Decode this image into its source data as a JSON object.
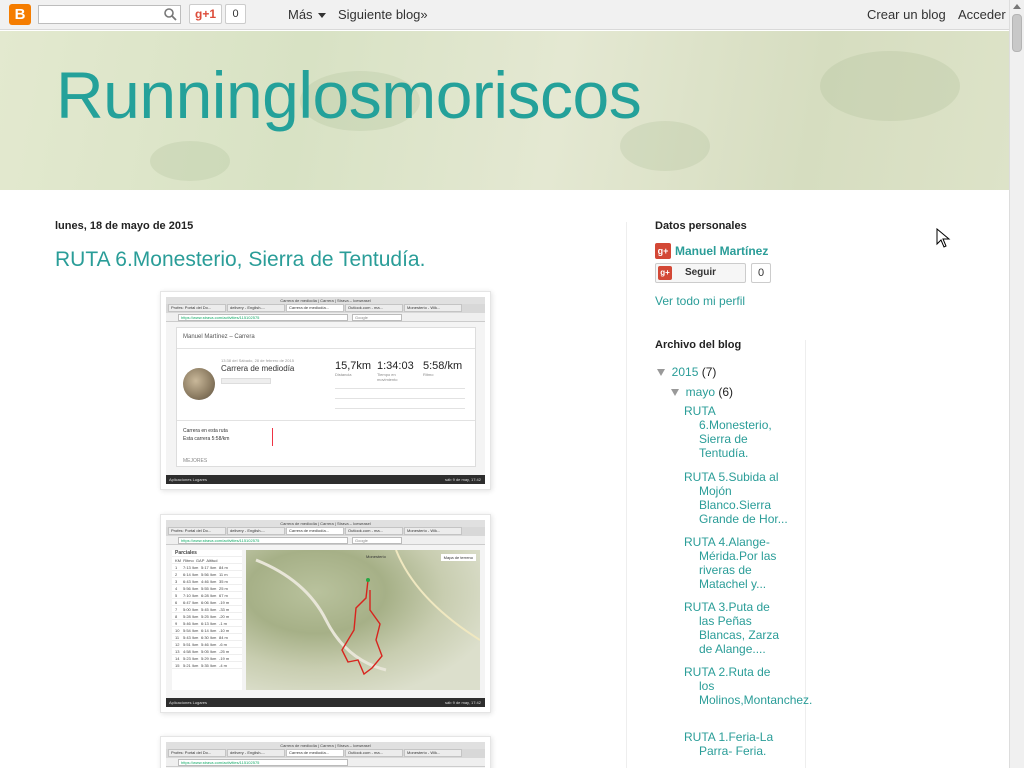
{
  "navbar": {
    "gplus_label": "g+1",
    "gplus_count": "0",
    "more_label": "Más",
    "next_blog_label": "Siguiente blog»",
    "create_blog_label": "Crear un blog",
    "login_label": "Acceder"
  },
  "header": {
    "title": "Runninglosmoriscos"
  },
  "post": {
    "date": "lunes, 18 de mayo de 2015",
    "title": "RUTA 6.Monesterio, Sierra de Tentudía."
  },
  "screens": {
    "window_title": "Carrera de mediodía | Carrera | Strava – Iceweasel",
    "tabs": [
      "Profes: Portal del Do...",
      "delivery - English-...",
      "Carrera de mediodía...",
      "Outlook.com - ma...",
      "Monesterio - Wik..."
    ],
    "url": "https://www.strava.com/activities/115102575",
    "search_placeholder": "Google",
    "taskbar": "Aplicaciones   Lugares",
    "taskbar_time": "sáb  9 de may, 17:42",
    "card": {
      "athlete": "Manuel Martínez – Carrera",
      "activity_date": "13:38 del Sábado, 28 de febrero de 2015",
      "activity_name": "Carrera de mediodía",
      "add_desc": "Añadir una descripción",
      "distance": "15,7km",
      "distance_label": "Distancia",
      "time": "1:34:03",
      "time_label": "Tiempo en movimiento",
      "pace": "5:58/km",
      "pace_label": "Ritmo",
      "segment_text": "Carrera en esta ruta",
      "segment_value": "Esta carrera 5:58/km",
      "best_label": "MEJORES",
      "goal": "Esta carrera"
    },
    "splits": {
      "title": "Parciales",
      "headers": [
        "KM",
        "Ritmo",
        "GAP",
        "Altitud"
      ],
      "rows": [
        [
          "1",
          "7:13 /km",
          "5:17 /km",
          "84 m"
        ],
        [
          "2",
          "6:14 /km",
          "5:56 /km",
          "11 m"
        ],
        [
          "3",
          "6:43 /km",
          "4:46 /km",
          "35 m"
        ],
        [
          "4",
          "5:56 /km",
          "5:55 /km",
          "25 m"
        ],
        [
          "5",
          "7:10 /km",
          "6:28 /km",
          "67 m"
        ],
        [
          "6",
          "6:47 /km",
          "6:06 /km",
          "-19 m"
        ],
        [
          "7",
          "5:00 /km",
          "5:45 /km",
          "-33 m"
        ],
        [
          "8",
          "5:28 /km",
          "5:25 /km",
          "-20 m"
        ],
        [
          "9",
          "5:46 /km",
          "6:13 /km",
          "-1 m"
        ],
        [
          "10",
          "5:54 /km",
          "6:14 /km",
          "-10 m"
        ],
        [
          "11",
          "5:43 /km",
          "6:30 /km",
          "84 m"
        ],
        [
          "12",
          "5:51 /km",
          "5:46 /km",
          "-6 m"
        ],
        [
          "13",
          "4:58 /km",
          "5:05 /km",
          "-25 m"
        ],
        [
          "14",
          "5:23 /km",
          "5:29 /km",
          "-19 m"
        ],
        [
          "15",
          "5:21 /km",
          "5:35 /km",
          "-4 m"
        ]
      ],
      "map_town": "Monesterio",
      "map_type": "Mapa de terreno"
    }
  },
  "sidebar": {
    "profile_heading": "Datos personales",
    "profile_name": "Manuel Martínez",
    "follow_label": "Seguir",
    "follow_count": "0",
    "view_profile": "Ver todo mi perfil",
    "archive_heading": "Archivo del blog",
    "year": "2015",
    "year_count": "(7)",
    "month": "mayo",
    "month_count": "(6)",
    "posts": [
      {
        "l1": "RUTA",
        "rest": "6.Monesterio, Sierra de Tentudía."
      },
      {
        "l1": "RUTA 5.Subida al",
        "rest": "Mojón Blanco.Sierra Grande de Hor..."
      },
      {
        "l1": "RUTA 4.Alange-",
        "rest": "Mérida.Por las riveras de Matachel y..."
      },
      {
        "l1": "RUTA 3.Puta de",
        "rest": "las Peñas Blancas, Zarza de Alange...."
      },
      {
        "l1": "RUTA 2.Ruta de",
        "rest": "los Molinos,Montanchez."
      },
      {
        "l1": "RUTA 1.Feria-La",
        "rest": "Parra- Feria."
      }
    ]
  },
  "colors": {
    "accent": "#2a9d98",
    "title": "#24a19a",
    "blogger_orange": "#f57d00",
    "gplus_red": "#d34836"
  },
  "icons": [
    "blogger-logo-icon",
    "search-icon",
    "gplus-icon",
    "caret-down-icon",
    "triangle-down-icon",
    "cursor-icon"
  ]
}
